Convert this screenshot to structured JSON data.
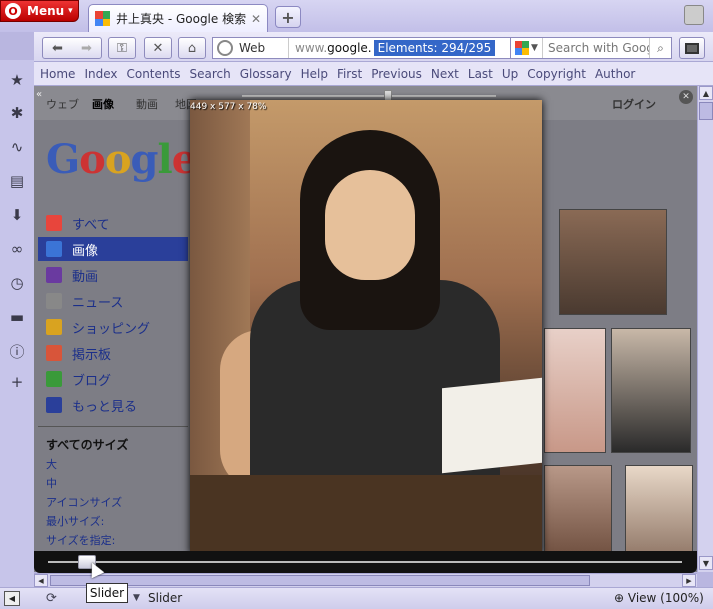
{
  "window": {
    "menu_label": "Menu",
    "tab_title": "井上真央 - Google 検索"
  },
  "toolbar": {
    "address_prefix": "Web",
    "url_text": "www.",
    "url_domain": "google.",
    "url_selection": "Elements:    294/295",
    "search_placeholder": "Search with Google"
  },
  "navbar": [
    "Home",
    "Index",
    "Contents",
    "Search",
    "Glossary",
    "Help",
    "First",
    "Previous",
    "Next",
    "Last",
    "Up",
    "Copyright",
    "Author"
  ],
  "google": {
    "top_links": [
      "ウェブ",
      "画像",
      "動画",
      "地図"
    ],
    "login": "ログイン",
    "logo": [
      "G",
      "o",
      "o",
      "g",
      "l",
      "e"
    ],
    "left_nav": [
      {
        "label": "すべて",
        "color": "#e8453c"
      },
      {
        "label": "画像",
        "color": "#3b74d6"
      },
      {
        "label": "動画",
        "color": "#6a3aa0"
      },
      {
        "label": "ニュース",
        "color": "#888888"
      },
      {
        "label": "ショッピング",
        "color": "#d9a320"
      },
      {
        "label": "掲示板",
        "color": "#d8553a"
      },
      {
        "label": "ブログ",
        "color": "#3a9a3a"
      },
      {
        "label": "もっと見る",
        "color": "#2a3f9a"
      }
    ],
    "sizes_title": "すべてのサイズ",
    "sizes": [
      "大",
      "中",
      "アイコンサイズ",
      "最小サイズ:",
      "サイズを指定:"
    ]
  },
  "viewer": {
    "info": "449 x 577 x 78%"
  },
  "status": {
    "text": "Slider",
    "zoom": "View (100%)",
    "tooltip": "Slider"
  }
}
